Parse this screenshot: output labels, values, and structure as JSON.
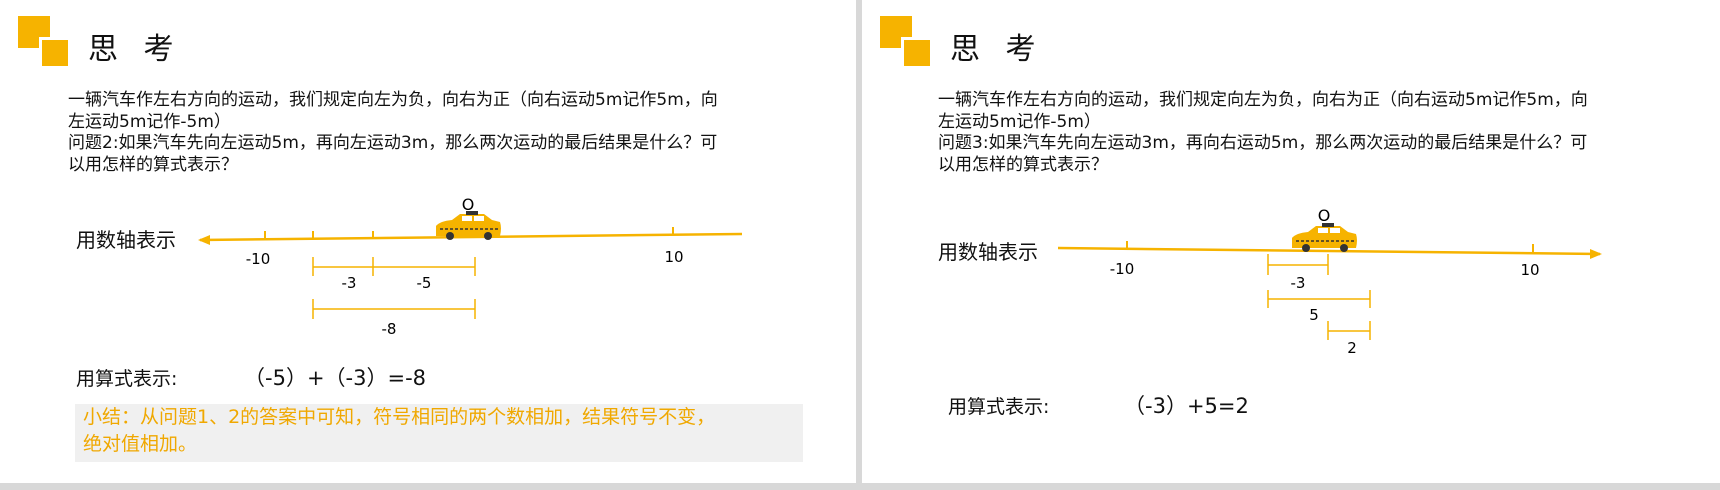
{
  "left": {
    "title": "思 考",
    "para_line1": "一辆汽车作左右方向的运动，我们规定向左为负，向右为正（向右运动5m记作5m，向",
    "para_line2": "左运动5m记作-5m）",
    "para_line3": "问题2:如果汽车先向左运动5m，再向左运动3m，那么两次运动的最后结果是什么？可",
    "para_line4": "以用怎样的算式表示？",
    "axis_label": "用数轴表示",
    "origin": "O",
    "tick_neg10": "-10",
    "tick_10": "10",
    "seg_a": "-3",
    "seg_b": "-5",
    "seg_total": "-8",
    "formula_label": "用算式表示:",
    "formula": "（-5）+（-3）=-8",
    "summary_line1": "小结：从问题1、2的答案中可知，符号相同的两个数相加，结果符号不变，",
    "summary_line2": "绝对值相加。"
  },
  "right": {
    "title": "思 考",
    "para_line1": "一辆汽车作左右方向的运动，我们规定向左为负，向右为正（向右运动5m记作5m，向",
    "para_line2": "左运动5m记作-5m）",
    "para_line3": "问题3:如果汽车先向左运动3m，再向右运动5m，那么两次运动的最后结果是什么？可",
    "para_line4": "以用怎样的算式表示？",
    "axis_label": "用数轴表示",
    "origin": "O",
    "tick_neg10": "-10",
    "tick_10": "10",
    "seg_a": "-3",
    "seg_b": "5",
    "seg_total": "2",
    "formula_label": "用算式表示:",
    "formula": "（-3）+5=2"
  },
  "colors": {
    "accent": "#f6b300",
    "summary_text": "#f0a800"
  }
}
